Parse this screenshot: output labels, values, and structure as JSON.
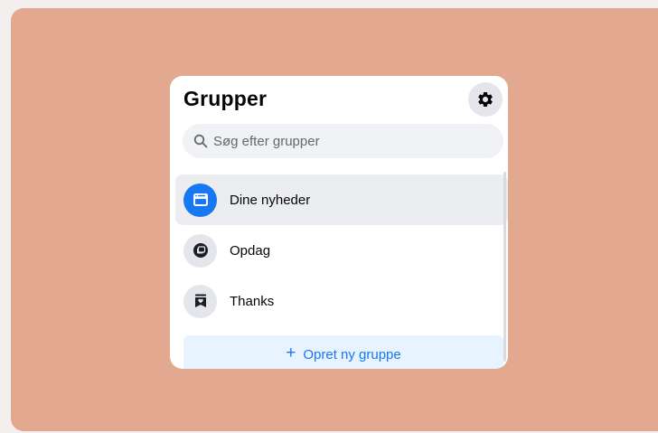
{
  "panel": {
    "title": "Grupper",
    "settings_icon": "gear-icon",
    "search": {
      "placeholder": "Søg efter grupper",
      "icon": "search-icon"
    },
    "items": [
      {
        "label": "Dine nyheder",
        "icon": "feed-icon",
        "active": true
      },
      {
        "label": "Opdag",
        "icon": "discover-icon",
        "active": false
      },
      {
        "label": "Thanks",
        "icon": "bookmark-heart-icon",
        "active": false
      }
    ],
    "create_button": {
      "plus": "+",
      "label": "Opret ny gruppe"
    }
  },
  "colors": {
    "backdrop": "#e3a990",
    "accent": "#1877f2",
    "active_row": "#ebedf0",
    "create_button_bg": "#e7f3ff"
  }
}
